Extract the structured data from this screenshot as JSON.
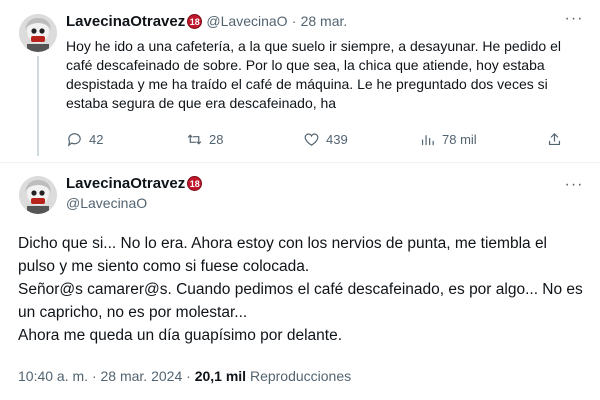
{
  "tweet1": {
    "display_name": "LavecinaOtravez",
    "badge": "18",
    "handle": "@LavecinaO",
    "separator": "·",
    "date": "28 mar.",
    "text": "Hoy he ido a una cafetería, a la que suelo ir siempre, a desayunar. He pedido el café descafeinado de sobre. Por lo que sea, la chica que atiende, hoy estaba despistada y me ha traído el café de máquina. Le he preguntado dos veces si estaba segura de que era descafeinado, ha",
    "actions": {
      "replies": "42",
      "retweets": "28",
      "likes": "439",
      "views": "78 mil"
    },
    "more_icon": "more-horizontal-icon"
  },
  "tweet2": {
    "display_name": "LavecinaOtravez",
    "badge": "18",
    "handle": "@LavecinaO",
    "text": "Dicho que si... No lo era. Ahora estoy con los nervios de punta, me tiembla el pulso y me siento como si fuese colocada.\nSeñor@s camarer@s. Cuando pedimos el café descafeinado, es por algo... No es un capricho, no es por molestar...\nAhora me queda un día guapísimo por delante.",
    "meta": {
      "time": "10:40 a. m.",
      "separator1": "·",
      "date": "28 mar. 2024",
      "separator2": "·",
      "views": "20,1 mil",
      "views_label": "Reproducciones"
    },
    "more_icon": "more-horizontal-icon"
  },
  "colors": {
    "text": "#0f1419",
    "muted": "#536471",
    "badge": "#c0182a",
    "divider": "#eff3f4"
  }
}
